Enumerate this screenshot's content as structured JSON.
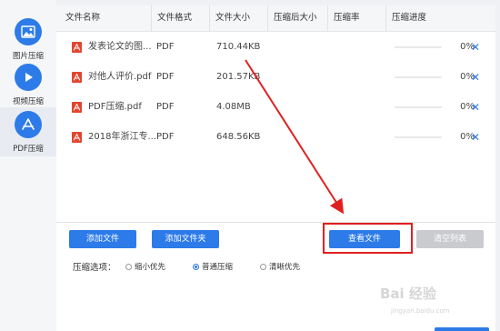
{
  "sidebar": {
    "items": [
      {
        "label": "图片压缩",
        "icon": "image-icon"
      },
      {
        "label": "视频压缩",
        "icon": "play-icon"
      },
      {
        "label": "PDF压缩",
        "icon": "pdf-icon"
      }
    ]
  },
  "table": {
    "headers": [
      "文件名称",
      "文件格式",
      "文件大小",
      "压缩后大小",
      "压缩率",
      "压缩进度"
    ],
    "rows": [
      {
        "name": "发表论文的图...",
        "format": "PDF",
        "size": "710.44KB",
        "progress": "0%",
        "progress_value": 0
      },
      {
        "name": "对他人评价.pdf",
        "format": "PDF",
        "size": "201.57KB",
        "progress": "0%",
        "progress_value": 0
      },
      {
        "name": "PDF压缩.pdf",
        "format": "PDF",
        "size": "4.08MB",
        "progress": "0%",
        "progress_value": 0
      },
      {
        "name": "2018年浙江专...",
        "format": "PDF",
        "size": "648.56KB",
        "progress": "0%",
        "progress_value": 0
      }
    ]
  },
  "buttons": {
    "add_file": "添加文件",
    "add_folder": "添加文件夹",
    "view_file": "查看文件",
    "clear_list": "清空列表"
  },
  "options": {
    "label": "压缩选项：",
    "choices": [
      "缩小优先",
      "普通压缩",
      "清晰优先"
    ],
    "selected": "普通压缩"
  },
  "watermark": {
    "text": "Bai 经验",
    "sub": "jingyan.baidu.com"
  },
  "colors": {
    "accent": "#2d7be8",
    "annotation": "#e02020",
    "pdf_icon": "#e2452f"
  }
}
